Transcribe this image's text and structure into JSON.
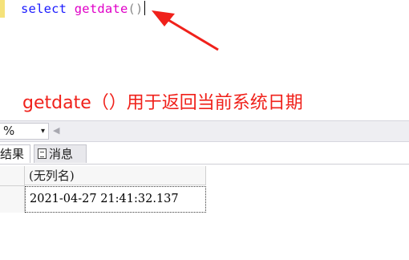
{
  "editor": {
    "keyword": "select",
    "function": "getdate",
    "parens": "()"
  },
  "annotation": {
    "text": "getdate（）用于返回当前系统日期",
    "color": "#f0211b"
  },
  "zoom": {
    "value": "%",
    "dropdown_glyph": "▾",
    "scroll_left_glyph": "◀"
  },
  "tabs": [
    {
      "label": "结果"
    },
    {
      "label": "消息"
    }
  ],
  "results": {
    "columns": [
      "(无列名)"
    ],
    "rows": [
      [
        "2021-04-27 21:41:32.137"
      ]
    ]
  },
  "colors": {
    "keyword": "#1a1aff",
    "function": "#e000c8",
    "paren": "#8a8a8a",
    "arrow": "#f0211b"
  }
}
